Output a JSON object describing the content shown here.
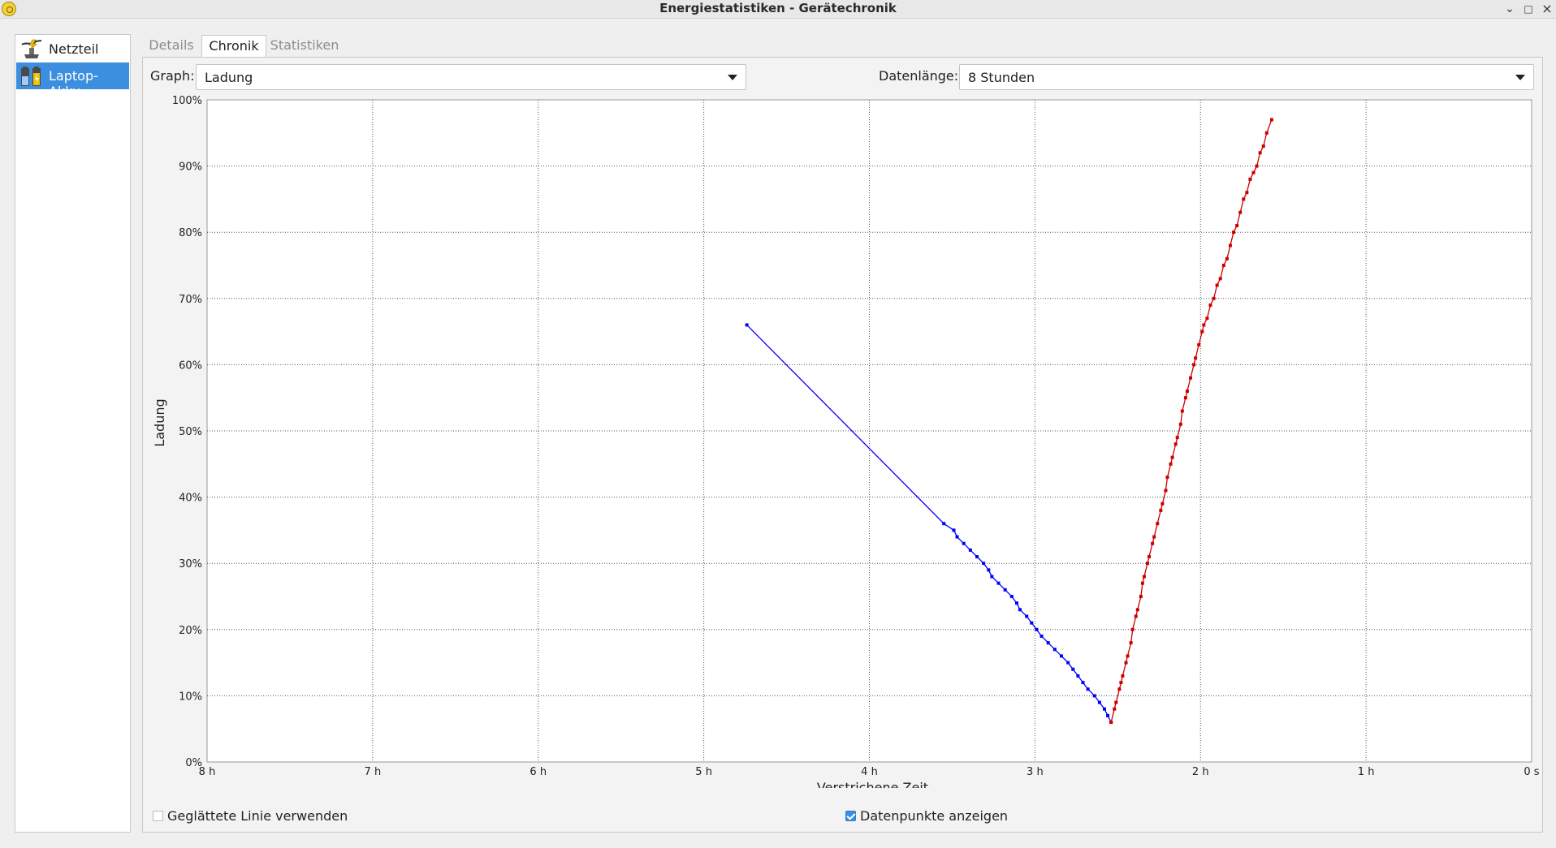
{
  "window": {
    "title": "Energiestatistiken - Gerätechronik"
  },
  "devices": [
    {
      "label": "Netzteil",
      "icon": "power-supply-icon",
      "selected": false
    },
    {
      "label": "Laptop-Akku",
      "icon": "laptop-battery-icon",
      "selected": true
    }
  ],
  "tabs": [
    {
      "label": "Details",
      "active": false
    },
    {
      "label": "Chronik",
      "active": true
    },
    {
      "label": "Statistiken",
      "active": false
    }
  ],
  "controls": {
    "graph_label": "Graph:",
    "graph_value": "Ladung",
    "length_label": "Datenlänge:",
    "length_value": "8 Stunden"
  },
  "options": {
    "smooth_label": "Geglättete Linie verwenden",
    "smooth_checked": false,
    "points_label": "Datenpunkte anzeigen",
    "points_checked": true
  },
  "chart_data": {
    "type": "line",
    "ylabel": "Ladung",
    "xlabel": "Verstrichene Zeit",
    "x_unit": "hours elapsed",
    "xlim": [
      8,
      0
    ],
    "ylim": [
      0,
      100
    ],
    "grid": true,
    "x_ticks": [
      {
        "v": 8,
        "label": "8 h"
      },
      {
        "v": 7,
        "label": "7 h"
      },
      {
        "v": 6,
        "label": "6 h"
      },
      {
        "v": 5,
        "label": "5 h"
      },
      {
        "v": 4,
        "label": "4 h"
      },
      {
        "v": 3,
        "label": "3 h"
      },
      {
        "v": 2,
        "label": "2 h"
      },
      {
        "v": 1,
        "label": "1 h"
      },
      {
        "v": 0,
        "label": "0 s"
      }
    ],
    "y_ticks": [
      {
        "v": 0,
        "label": "0%"
      },
      {
        "v": 10,
        "label": "10%"
      },
      {
        "v": 20,
        "label": "20%"
      },
      {
        "v": 30,
        "label": "30%"
      },
      {
        "v": 40,
        "label": "40%"
      },
      {
        "v": 50,
        "label": "50%"
      },
      {
        "v": 60,
        "label": "60%"
      },
      {
        "v": 70,
        "label": "70%"
      },
      {
        "v": 80,
        "label": "80%"
      },
      {
        "v": 90,
        "label": "90%"
      },
      {
        "v": 100,
        "label": "100%"
      }
    ],
    "series": [
      {
        "state": "discharging",
        "color": "#0000ff",
        "points": [
          [
            4.74,
            66
          ],
          [
            3.55,
            36
          ],
          [
            3.49,
            35
          ],
          [
            3.47,
            34
          ],
          [
            3.43,
            33
          ],
          [
            3.39,
            32
          ],
          [
            3.35,
            31
          ],
          [
            3.31,
            30
          ],
          [
            3.28,
            29
          ],
          [
            3.26,
            28
          ],
          [
            3.22,
            27
          ],
          [
            3.18,
            26
          ],
          [
            3.14,
            25
          ],
          [
            3.11,
            24
          ],
          [
            3.09,
            23
          ],
          [
            3.05,
            22
          ],
          [
            3.02,
            21
          ],
          [
            2.99,
            20
          ],
          [
            2.96,
            19
          ],
          [
            2.92,
            18
          ],
          [
            2.88,
            17
          ],
          [
            2.84,
            16
          ],
          [
            2.8,
            15
          ],
          [
            2.77,
            14
          ],
          [
            2.74,
            13
          ],
          [
            2.71,
            12
          ],
          [
            2.68,
            11
          ],
          [
            2.64,
            10
          ],
          [
            2.61,
            9
          ],
          [
            2.58,
            8
          ],
          [
            2.56,
            7
          ],
          [
            2.54,
            6
          ]
        ]
      },
      {
        "state": "charging",
        "color": "#cc0000",
        "points": [
          [
            2.54,
            6
          ],
          [
            2.52,
            8
          ],
          [
            2.51,
            9
          ],
          [
            2.49,
            11
          ],
          [
            2.48,
            12
          ],
          [
            2.47,
            13
          ],
          [
            2.45,
            15
          ],
          [
            2.44,
            16
          ],
          [
            2.42,
            18
          ],
          [
            2.41,
            20
          ],
          [
            2.39,
            22
          ],
          [
            2.38,
            23
          ],
          [
            2.36,
            25
          ],
          [
            2.35,
            27
          ],
          [
            2.34,
            28
          ],
          [
            2.32,
            30
          ],
          [
            2.31,
            31
          ],
          [
            2.29,
            33
          ],
          [
            2.28,
            34
          ],
          [
            2.26,
            36
          ],
          [
            2.24,
            38
          ],
          [
            2.23,
            39
          ],
          [
            2.21,
            41
          ],
          [
            2.2,
            43
          ],
          [
            2.18,
            45
          ],
          [
            2.17,
            46
          ],
          [
            2.15,
            48
          ],
          [
            2.14,
            49
          ],
          [
            2.12,
            51
          ],
          [
            2.11,
            53
          ],
          [
            2.09,
            55
          ],
          [
            2.08,
            56
          ],
          [
            2.06,
            58
          ],
          [
            2.04,
            60
          ],
          [
            2.03,
            61
          ],
          [
            2.01,
            63
          ],
          [
            1.99,
            65
          ],
          [
            1.98,
            66
          ],
          [
            1.96,
            67
          ],
          [
            1.94,
            69
          ],
          [
            1.92,
            70
          ],
          [
            1.9,
            72
          ],
          [
            1.88,
            73
          ],
          [
            1.86,
            75
          ],
          [
            1.84,
            76
          ],
          [
            1.82,
            78
          ],
          [
            1.8,
            80
          ],
          [
            1.78,
            81
          ],
          [
            1.76,
            83
          ],
          [
            1.74,
            85
          ],
          [
            1.72,
            86
          ],
          [
            1.7,
            88
          ],
          [
            1.68,
            89
          ],
          [
            1.66,
            90
          ],
          [
            1.64,
            92
          ],
          [
            1.62,
            93
          ],
          [
            1.6,
            95
          ],
          [
            1.57,
            97
          ]
        ]
      }
    ]
  }
}
